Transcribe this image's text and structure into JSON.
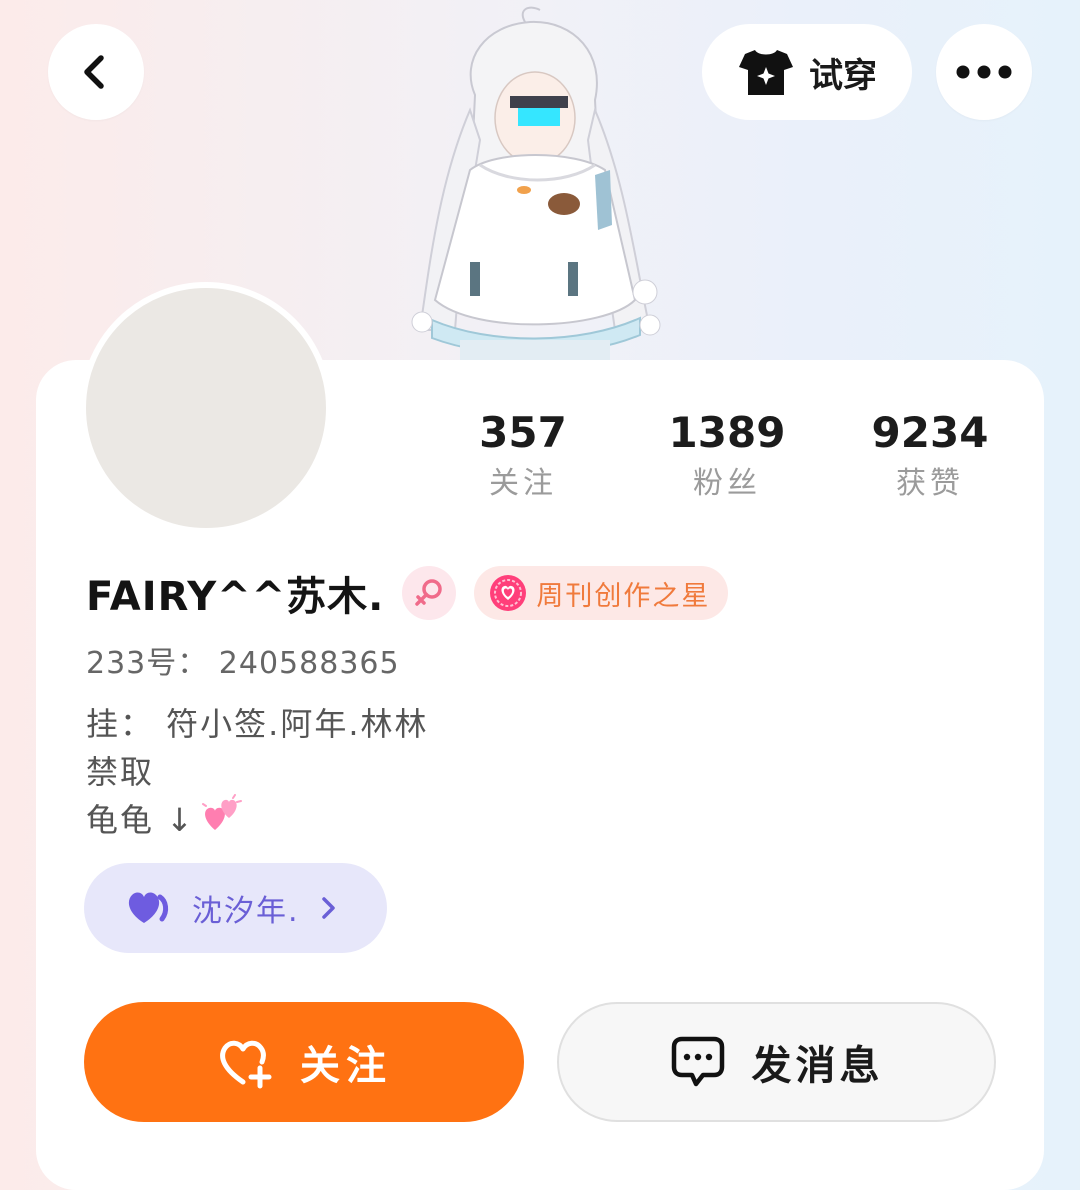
{
  "header": {
    "try_on_label": "试穿",
    "back_icon": "chevron-left-icon",
    "more_icon": "more-dots-icon",
    "try_on_icon": "tshirt-star-icon"
  },
  "profile": {
    "username": "FAIRY^^苏木.",
    "gender": "female",
    "badge_label": "周刊创作之星",
    "id_line": "233号： 240588365",
    "bio_lines": [
      "挂： 符小签.阿年.林林",
      "禁取",
      "龟龟 ↓"
    ],
    "bio_emoji": "💞"
  },
  "stats": [
    {
      "value": "357",
      "label": "关注"
    },
    {
      "value": "1389",
      "label": "粉丝"
    },
    {
      "value": "9234",
      "label": "获赞"
    }
  ],
  "cp": {
    "name": "沈汐年.",
    "icon": "purple-heart-icon"
  },
  "actions": {
    "follow_label": "关注",
    "message_label": "发消息"
  },
  "colors": {
    "accent": "#ff7212",
    "cp_bg": "#e7e7fa",
    "cp_text": "#6a5fd6",
    "badge_text": "#f07a3c"
  }
}
